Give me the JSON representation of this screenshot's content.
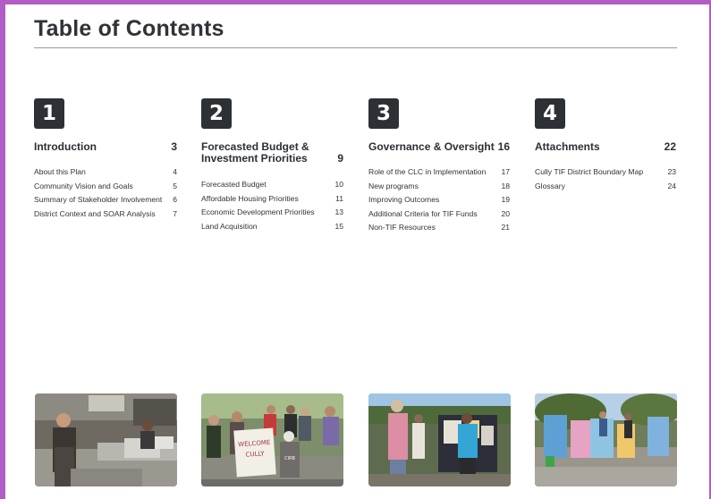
{
  "title": "Table of Contents",
  "sections": [
    {
      "number": "1",
      "title": "Introduction",
      "page": "3",
      "items": [
        {
          "label": "About this Plan",
          "page": "4"
        },
        {
          "label": "Community Vision and Goals",
          "page": "5"
        },
        {
          "label": "Summary of Stakeholder Involvement",
          "page": "6"
        },
        {
          "label": "District Context and SOAR Analysis",
          "page": "7"
        }
      ]
    },
    {
      "number": "2",
      "title": "Forecasted Budget & Investment Priorities",
      "page": "9",
      "items": [
        {
          "label": "Forecasted Budget",
          "page": "10"
        },
        {
          "label": "Affordable Housing Priorities",
          "page": "11"
        },
        {
          "label": "Economic Development Priorities",
          "page": "13"
        },
        {
          "label": "Land Acquisition",
          "page": "15"
        }
      ]
    },
    {
      "number": "3",
      "title": "Governance & Oversight",
      "page": "16",
      "items": [
        {
          "label": "Role of the CLC in Implementation",
          "page": "17"
        },
        {
          "label": "New programs",
          "page": "18"
        },
        {
          "label": "Improving Outcomes",
          "page": "19"
        },
        {
          "label": "Additional Criteria for TIF Funds",
          "page": "20"
        },
        {
          "label": "Non-TIF Resources",
          "page": "21"
        }
      ]
    },
    {
      "number": "4",
      "title": "Attachments",
      "page": "22",
      "items": [
        {
          "label": "Cully TIF District Boundary Map",
          "page": "23"
        },
        {
          "label": "Glossary",
          "page": "24"
        }
      ]
    }
  ],
  "photos": {
    "sign_text_1": "WELCOME",
    "sign_text_2": "CULLY",
    "shirt_text": "CIRB"
  },
  "colors": {
    "frame": "#b25cc6",
    "badge": "#2d3136",
    "title": "#2f3338"
  }
}
